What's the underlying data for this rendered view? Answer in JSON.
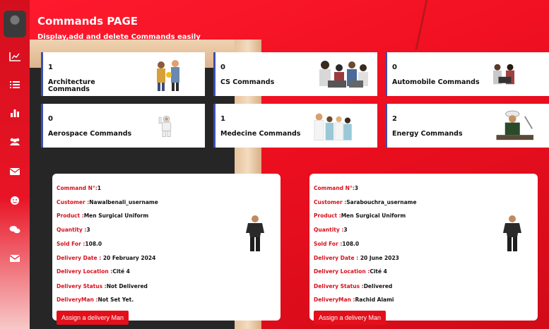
{
  "header": {
    "title": "Commands PAGE",
    "subtitle": "Display,add and delete Commands easily"
  },
  "sidebar": {
    "items": [
      {
        "icon": "chart-line-icon"
      },
      {
        "icon": "list-icon"
      },
      {
        "icon": "bar-chart-icon"
      },
      {
        "icon": "users-icon"
      },
      {
        "icon": "envelope-icon"
      },
      {
        "icon": "smiley-icon"
      },
      {
        "icon": "chat-icon"
      },
      {
        "icon": "mail-icon"
      }
    ]
  },
  "categories": [
    {
      "count": "1",
      "label_line1": "Architecture",
      "label_line2": "Commands"
    },
    {
      "count": "0",
      "label_line1": "CS Commands",
      "label_line2": ""
    },
    {
      "count": "0",
      "label_line1": "Automobile Commands",
      "label_line2": ""
    },
    {
      "count": "0",
      "label_line1": "Aerospace Commands",
      "label_line2": ""
    },
    {
      "count": "1",
      "label_line1": "Medecine Commands",
      "label_line2": ""
    },
    {
      "count": "2",
      "label_line1": "Energy Commands",
      "label_line2": ""
    }
  ],
  "commands": [
    {
      "number_label": "Command N°:",
      "number": "1",
      "customer_label": "Customer :",
      "customer": "Nawalbenali_username",
      "product_label": "Product :",
      "product": "Men Surgical Uniform",
      "quantity_label": "Quantity :",
      "quantity": "3",
      "sold_label": "Sold For :",
      "sold": "108.0",
      "date_label": "Delivery Date :",
      "date": " 20 February 2024",
      "location_label": "Delivery Location :",
      "location": "Cité 4",
      "status_label": "Delivery Status :",
      "status": "Not Delivered",
      "man_label": "DeliveryMan :",
      "man": "Not Set Yet.",
      "button": "Assign a delivery Man"
    },
    {
      "number_label": "Command N°:",
      "number": "3",
      "customer_label": "Customer :",
      "customer": "Sarabouchra_username",
      "product_label": "Product :",
      "product": "Men Surgical Uniform",
      "quantity_label": "Quantity :",
      "quantity": "3",
      "sold_label": "Sold For :",
      "sold": "108.0",
      "date_label": "Delivery Date :",
      "date": " 20 June 2023",
      "location_label": "Delivery Location :",
      "location": "Cité 4",
      "status_label": "Delivery Status :",
      "status": "Delivered",
      "man_label": "DeliveryMan :",
      "man": "Rachid Alami",
      "button": "Assign a delivery Man"
    }
  ],
  "colors": {
    "accent": "#e3101c",
    "card_border": "#3b4fb0"
  }
}
